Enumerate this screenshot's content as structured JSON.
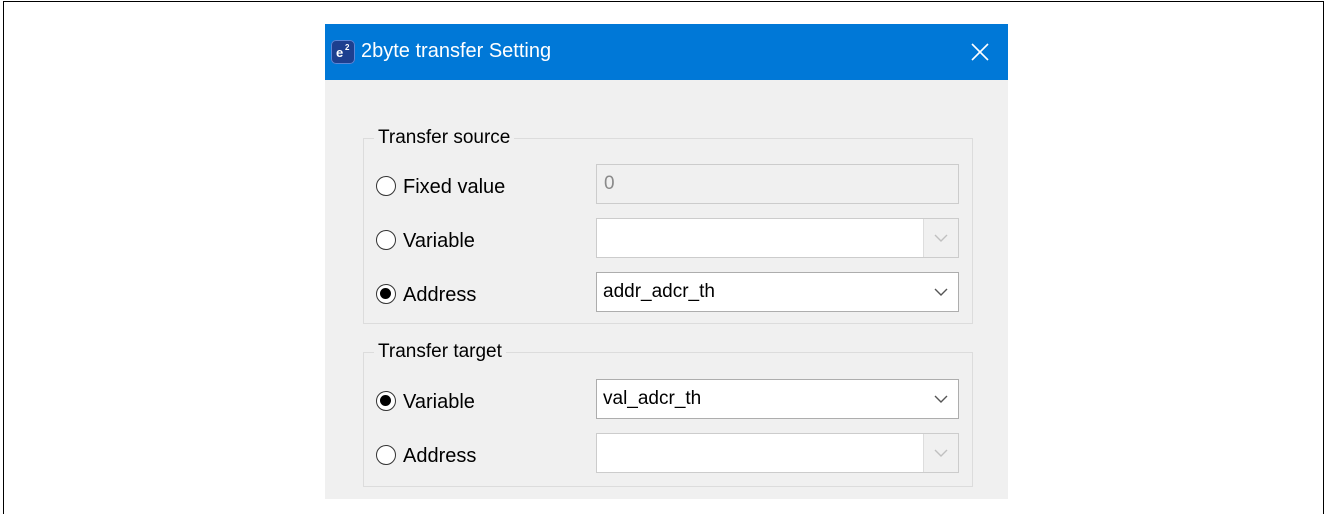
{
  "dialog": {
    "title": "2byte transfer Setting",
    "app_icon": "e2-icon",
    "close_icon": "close-icon"
  },
  "source": {
    "legend": "Transfer source",
    "fixed_label": "Fixed value",
    "fixed_value": "0",
    "variable_label": "Variable",
    "variable_value": "",
    "address_label": "Address",
    "address_value": "addr_adcr_th",
    "selected": "address"
  },
  "target": {
    "legend": "Transfer target",
    "variable_label": "Variable",
    "variable_value": "val_adcr_th",
    "address_label": "Address",
    "address_value": "",
    "selected": "variable"
  },
  "colors": {
    "titlebar": "#0078d7",
    "dialog_bg": "#f0f0f0"
  }
}
